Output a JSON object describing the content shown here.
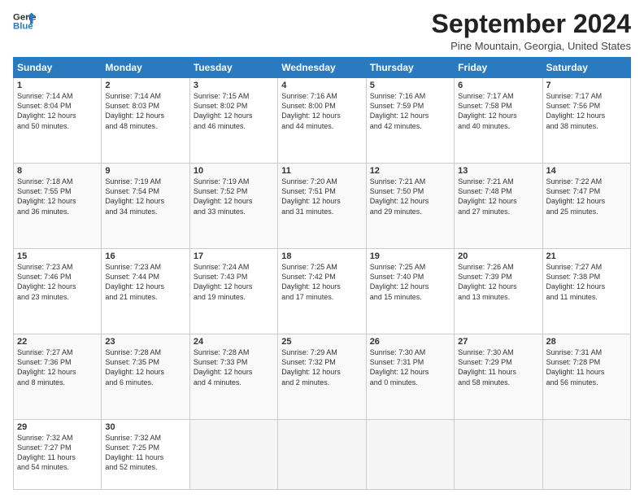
{
  "header": {
    "logo_line1": "General",
    "logo_line2": "Blue",
    "month": "September 2024",
    "location": "Pine Mountain, Georgia, United States"
  },
  "weekdays": [
    "Sunday",
    "Monday",
    "Tuesday",
    "Wednesday",
    "Thursday",
    "Friday",
    "Saturday"
  ],
  "weeks": [
    [
      {
        "day": "1",
        "info": "Sunrise: 7:14 AM\nSunset: 8:04 PM\nDaylight: 12 hours\nand 50 minutes."
      },
      {
        "day": "2",
        "info": "Sunrise: 7:14 AM\nSunset: 8:03 PM\nDaylight: 12 hours\nand 48 minutes."
      },
      {
        "day": "3",
        "info": "Sunrise: 7:15 AM\nSunset: 8:02 PM\nDaylight: 12 hours\nand 46 minutes."
      },
      {
        "day": "4",
        "info": "Sunrise: 7:16 AM\nSunset: 8:00 PM\nDaylight: 12 hours\nand 44 minutes."
      },
      {
        "day": "5",
        "info": "Sunrise: 7:16 AM\nSunset: 7:59 PM\nDaylight: 12 hours\nand 42 minutes."
      },
      {
        "day": "6",
        "info": "Sunrise: 7:17 AM\nSunset: 7:58 PM\nDaylight: 12 hours\nand 40 minutes."
      },
      {
        "day": "7",
        "info": "Sunrise: 7:17 AM\nSunset: 7:56 PM\nDaylight: 12 hours\nand 38 minutes."
      }
    ],
    [
      {
        "day": "8",
        "info": "Sunrise: 7:18 AM\nSunset: 7:55 PM\nDaylight: 12 hours\nand 36 minutes."
      },
      {
        "day": "9",
        "info": "Sunrise: 7:19 AM\nSunset: 7:54 PM\nDaylight: 12 hours\nand 34 minutes."
      },
      {
        "day": "10",
        "info": "Sunrise: 7:19 AM\nSunset: 7:52 PM\nDaylight: 12 hours\nand 33 minutes."
      },
      {
        "day": "11",
        "info": "Sunrise: 7:20 AM\nSunset: 7:51 PM\nDaylight: 12 hours\nand 31 minutes."
      },
      {
        "day": "12",
        "info": "Sunrise: 7:21 AM\nSunset: 7:50 PM\nDaylight: 12 hours\nand 29 minutes."
      },
      {
        "day": "13",
        "info": "Sunrise: 7:21 AM\nSunset: 7:48 PM\nDaylight: 12 hours\nand 27 minutes."
      },
      {
        "day": "14",
        "info": "Sunrise: 7:22 AM\nSunset: 7:47 PM\nDaylight: 12 hours\nand 25 minutes."
      }
    ],
    [
      {
        "day": "15",
        "info": "Sunrise: 7:23 AM\nSunset: 7:46 PM\nDaylight: 12 hours\nand 23 minutes."
      },
      {
        "day": "16",
        "info": "Sunrise: 7:23 AM\nSunset: 7:44 PM\nDaylight: 12 hours\nand 21 minutes."
      },
      {
        "day": "17",
        "info": "Sunrise: 7:24 AM\nSunset: 7:43 PM\nDaylight: 12 hours\nand 19 minutes."
      },
      {
        "day": "18",
        "info": "Sunrise: 7:25 AM\nSunset: 7:42 PM\nDaylight: 12 hours\nand 17 minutes."
      },
      {
        "day": "19",
        "info": "Sunrise: 7:25 AM\nSunset: 7:40 PM\nDaylight: 12 hours\nand 15 minutes."
      },
      {
        "day": "20",
        "info": "Sunrise: 7:26 AM\nSunset: 7:39 PM\nDaylight: 12 hours\nand 13 minutes."
      },
      {
        "day": "21",
        "info": "Sunrise: 7:27 AM\nSunset: 7:38 PM\nDaylight: 12 hours\nand 11 minutes."
      }
    ],
    [
      {
        "day": "22",
        "info": "Sunrise: 7:27 AM\nSunset: 7:36 PM\nDaylight: 12 hours\nand 8 minutes."
      },
      {
        "day": "23",
        "info": "Sunrise: 7:28 AM\nSunset: 7:35 PM\nDaylight: 12 hours\nand 6 minutes."
      },
      {
        "day": "24",
        "info": "Sunrise: 7:28 AM\nSunset: 7:33 PM\nDaylight: 12 hours\nand 4 minutes."
      },
      {
        "day": "25",
        "info": "Sunrise: 7:29 AM\nSunset: 7:32 PM\nDaylight: 12 hours\nand 2 minutes."
      },
      {
        "day": "26",
        "info": "Sunrise: 7:30 AM\nSunset: 7:31 PM\nDaylight: 12 hours\nand 0 minutes."
      },
      {
        "day": "27",
        "info": "Sunrise: 7:30 AM\nSunset: 7:29 PM\nDaylight: 11 hours\nand 58 minutes."
      },
      {
        "day": "28",
        "info": "Sunrise: 7:31 AM\nSunset: 7:28 PM\nDaylight: 11 hours\nand 56 minutes."
      }
    ],
    [
      {
        "day": "29",
        "info": "Sunrise: 7:32 AM\nSunset: 7:27 PM\nDaylight: 11 hours\nand 54 minutes."
      },
      {
        "day": "30",
        "info": "Sunrise: 7:32 AM\nSunset: 7:25 PM\nDaylight: 11 hours\nand 52 minutes."
      },
      {
        "day": "",
        "info": ""
      },
      {
        "day": "",
        "info": ""
      },
      {
        "day": "",
        "info": ""
      },
      {
        "day": "",
        "info": ""
      },
      {
        "day": "",
        "info": ""
      }
    ]
  ]
}
